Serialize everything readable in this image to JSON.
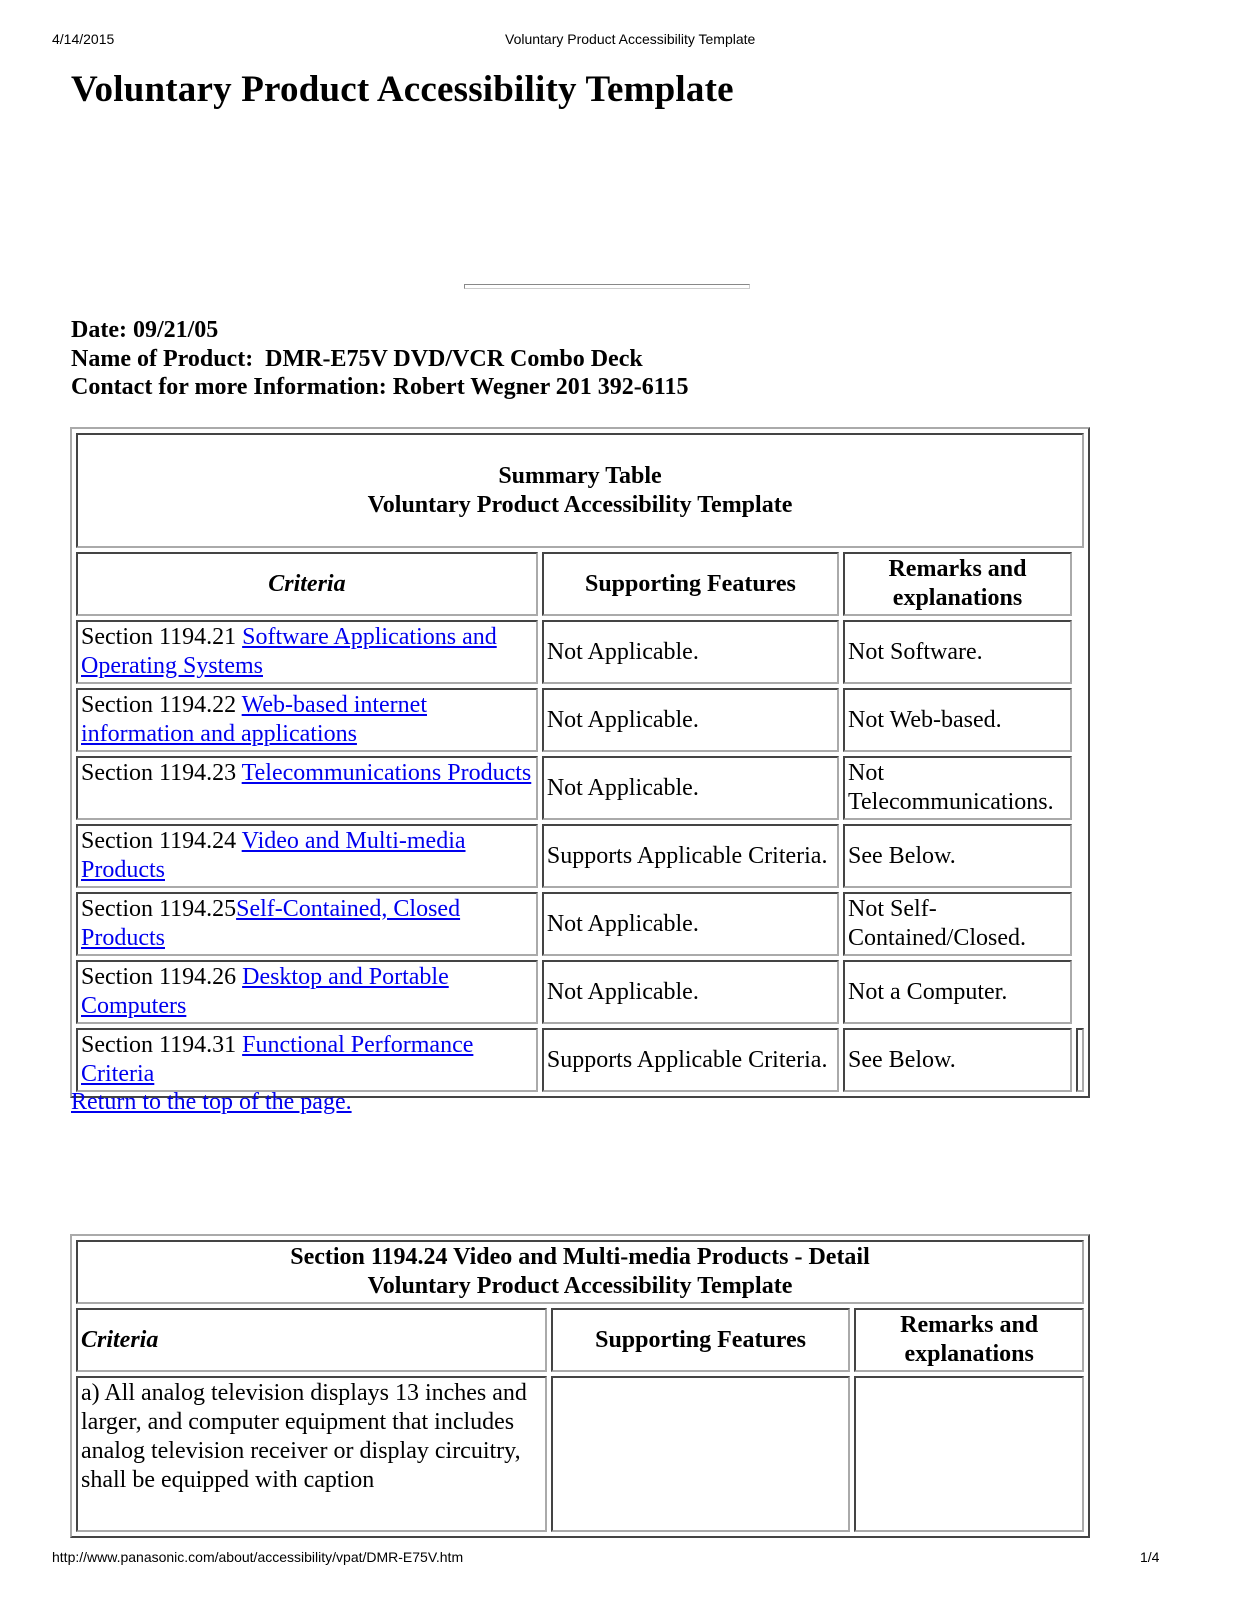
{
  "print_header": {
    "date": "4/14/2015",
    "title": "Voluntary Product Accessibility Template"
  },
  "print_footer": {
    "url": "http://www.panasonic.com/about/accessibility/vpat/DMR-E75V.htm",
    "page": "1/4"
  },
  "page_title": "Voluntary Product Accessibility Template",
  "info": {
    "date": "Date: 09/21/05",
    "product": "Name of Product:  DMR-E75V DVD/VCR Combo Deck",
    "contact": "Contact for more Information: Robert Wegner 201 392-6115"
  },
  "summary_table": {
    "title_line1": "Summary Table",
    "title_line2": "Voluntary Product Accessibility Template",
    "headers": {
      "criteria": "Criteria",
      "supporting": "Supporting Features",
      "remarks_line1": "Remarks and",
      "remarks_line2": "explanations"
    },
    "rows": [
      {
        "section": "Section 1194.21 ",
        "link": "Software Applications and Operating Systems",
        "supporting": "Not Applicable.",
        "remarks": "Not Software."
      },
      {
        "section": "Section 1194.22 ",
        "link": "Web-based internet information and applications",
        "supporting": "Not Applicable.",
        "remarks": "Not Web-based."
      },
      {
        "section": "Section 1194.23 ",
        "link": "Telecommunications Products",
        "supporting": "Not Applicable.",
        "remarks": "Not Telecommunications."
      },
      {
        "section": "Section 1194.24 ",
        "link": "Video and Multi-media Products",
        "supporting": "Supports Applicable Criteria.",
        "remarks": "See Below."
      },
      {
        "section": "Section 1194.25",
        "link": "Self-Contained, Closed Products",
        "supporting": "Not Applicable.",
        "remarks": "Not Self-Contained/Closed."
      },
      {
        "section": "Section 1194.26 ",
        "link": "Desktop and Portable Computers",
        "supporting": "Not Applicable.",
        "remarks": "Not a Computer."
      },
      {
        "section": "Section 1194.31 ",
        "link": "Functional Performance Criteria",
        "supporting": "Supports Applicable Criteria.",
        "remarks": "See Below."
      }
    ]
  },
  "return_link": "Return to the top of the page.",
  "detail_table": {
    "title_line1": "Section 1194.24 Video and Multi-media Products - Detail",
    "title_line2": "Voluntary Product Accessibility Template",
    "headers": {
      "criteria": "Criteria",
      "supporting": "Supporting Features",
      "remarks_line1": "Remarks and",
      "remarks_line2": "explanations"
    },
    "rows": [
      {
        "criteria": "a) All analog television displays 13 inches and larger, and computer equipment that includes analog television receiver or display circuitry, shall be equipped with caption",
        "supporting": "",
        "remarks": ""
      }
    ]
  }
}
